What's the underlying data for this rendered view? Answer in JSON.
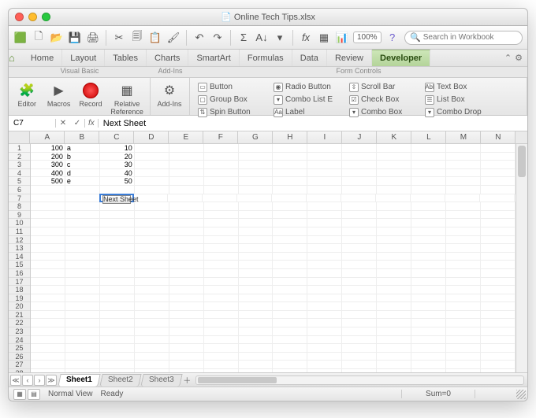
{
  "window": {
    "title": "Online Tech Tips.xlsx"
  },
  "toolbar": {
    "zoom": "100%",
    "search_placeholder": "Search in Workbook"
  },
  "tabs": [
    "Home",
    "Layout",
    "Tables",
    "Charts",
    "SmartArt",
    "Formulas",
    "Data",
    "Review",
    "Developer"
  ],
  "active_tab": "Developer",
  "ribbon": {
    "groups": {
      "visual_basic": {
        "title": "Visual Basic",
        "editor": "Editor",
        "macros": "Macros",
        "record": "Record",
        "relref": "Relative Reference"
      },
      "addins": {
        "title": "Add-Ins",
        "addins": "Add-Ins"
      },
      "form_controls": {
        "title": "Form Controls",
        "items": [
          "Button",
          "Radio Button",
          "Scroll Bar",
          "Text Box",
          "Group Box",
          "Combo List E",
          "Check Box",
          "List Box",
          "Spin Button",
          "Label",
          "Combo Box",
          "Combo Drop"
        ]
      }
    }
  },
  "formula_bar": {
    "name_box": "C7",
    "fx": "fx",
    "content": "Next Sheet"
  },
  "columns": [
    "A",
    "B",
    "C",
    "D",
    "E",
    "F",
    "G",
    "H",
    "I",
    "J",
    "K",
    "L",
    "M",
    "N"
  ],
  "row_count": 33,
  "data_rows": [
    {
      "A": "100",
      "B": "a",
      "C": "10"
    },
    {
      "A": "200",
      "B": "b",
      "C": "20"
    },
    {
      "A": "300",
      "B": "c",
      "C": "30"
    },
    {
      "A": "400",
      "B": "d",
      "C": "40"
    },
    {
      "A": "500",
      "B": "e",
      "C": "50"
    }
  ],
  "button_cell": {
    "row": 7,
    "col": "C",
    "label": "Next Sheet"
  },
  "selected_cell": {
    "row": 7,
    "col": "C"
  },
  "sheet_tabs": [
    "Sheet1",
    "Sheet2",
    "Sheet3"
  ],
  "active_sheet": "Sheet1",
  "status": {
    "view": "Normal View",
    "ready": "Ready",
    "sum": "Sum=0"
  }
}
